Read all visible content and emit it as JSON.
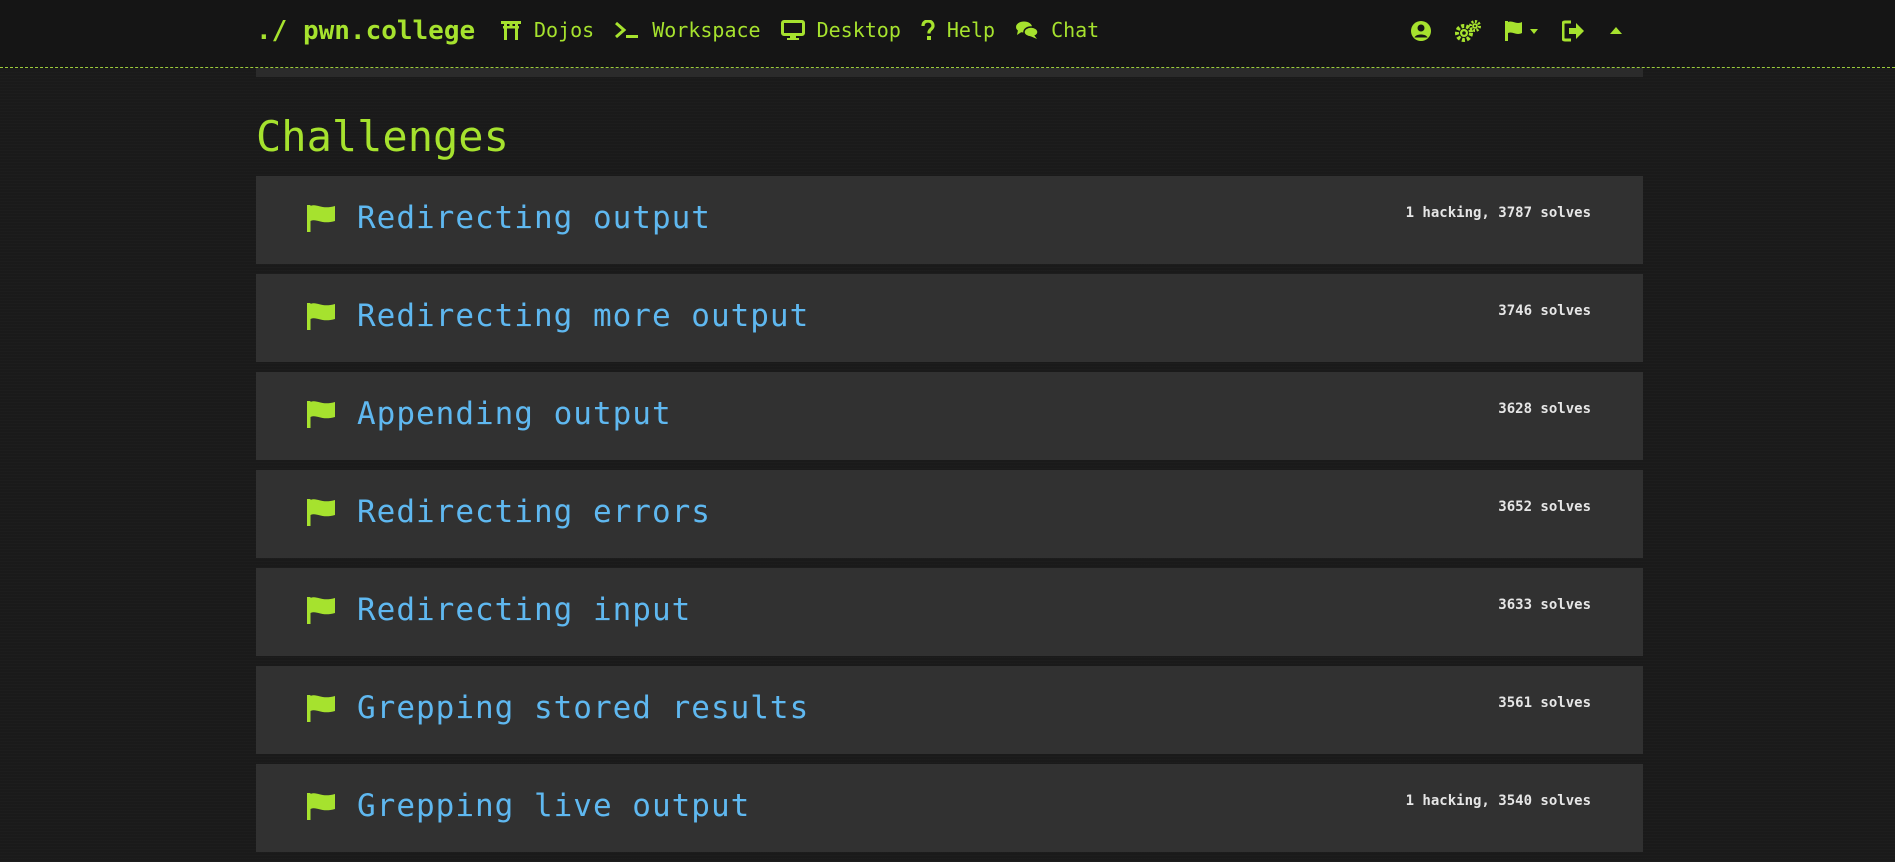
{
  "brand": "./ pwn.college",
  "nav": {
    "links": [
      {
        "label": "Dojos",
        "icon": "torii-gate-icon"
      },
      {
        "label": "Workspace",
        "icon": "terminal-icon"
      },
      {
        "label": "Desktop",
        "icon": "desktop-icon"
      },
      {
        "label": "Help",
        "icon": "question-icon"
      },
      {
        "label": "Chat",
        "icon": "chat-icon"
      }
    ],
    "right_icons": [
      "user-circle-icon",
      "gears-icon",
      "flag-dropdown-icon",
      "logout-icon",
      "collapse-icon"
    ]
  },
  "colors": {
    "accent": "#a6e22e",
    "link": "#5fb8f0",
    "card_bg": "#313131",
    "page_bg": "#1a1a1a"
  },
  "heading": "Challenges",
  "challenges": [
    {
      "title": "Redirecting output",
      "stat": "1 hacking, 3787 solves"
    },
    {
      "title": "Redirecting more output",
      "stat": "3746 solves"
    },
    {
      "title": "Appending output",
      "stat": "3628 solves"
    },
    {
      "title": "Redirecting errors",
      "stat": "3652 solves"
    },
    {
      "title": "Redirecting input",
      "stat": "3633 solves"
    },
    {
      "title": "Grepping stored results",
      "stat": "3561 solves"
    },
    {
      "title": "Grepping live output",
      "stat": "1 hacking, 3540 solves"
    }
  ]
}
